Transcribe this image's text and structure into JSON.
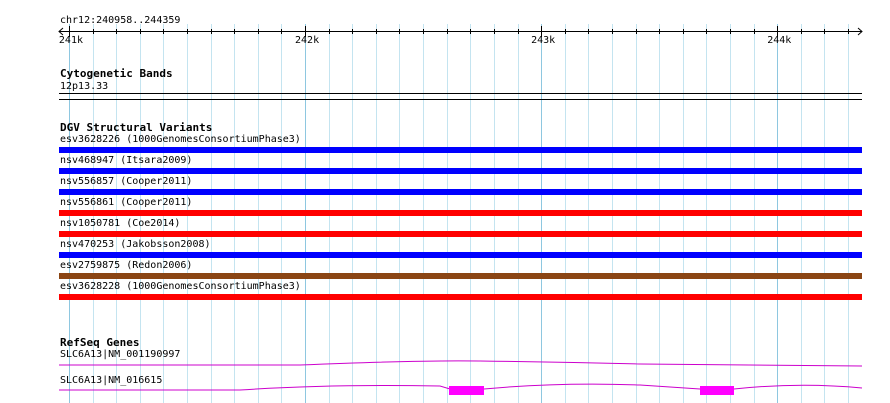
{
  "ruler": {
    "region": "chr12:240958..244359",
    "ticks": [
      {
        "label": "241k",
        "pos": 241000
      },
      {
        "label": "242k",
        "pos": 242000
      },
      {
        "label": "243k",
        "pos": 243000
      },
      {
        "label": "244k",
        "pos": 244000
      }
    ]
  },
  "cytoband": {
    "title": "Cytogenetic Bands",
    "band": "12p13.33"
  },
  "dgv": {
    "title": "DGV Structural Variants",
    "variants": [
      {
        "label": "esv3628226 (1000GenomesConsortiumPhase3)",
        "color": "#0000ff"
      },
      {
        "label": "nsv468947 (Itsara2009)",
        "color": "#0000ff"
      },
      {
        "label": "nsv556857 (Cooper2011)",
        "color": "#0000ff"
      },
      {
        "label": "nsv556861 (Cooper2011)",
        "color": "#ff0000"
      },
      {
        "label": "nsv1050781 (Coe2014)",
        "color": "#ff0000"
      },
      {
        "label": "nsv470253 (Jakobsson2008)",
        "color": "#0000ff"
      },
      {
        "label": "esv2759875 (Redon2006)",
        "color": "#8b4513"
      },
      {
        "label": "esv3628228 (1000GenomesConsortiumPhase3)",
        "color": "#ff0000"
      }
    ]
  },
  "refseq": {
    "title": "RefSeq Genes",
    "genes": [
      {
        "label": "SLC6A13|NM_001190997",
        "color": "#cc00cc"
      },
      {
        "label": "SLC6A13|NM_016615",
        "color": "#cc00cc",
        "exon_color": "#ff00ff"
      }
    ]
  }
}
